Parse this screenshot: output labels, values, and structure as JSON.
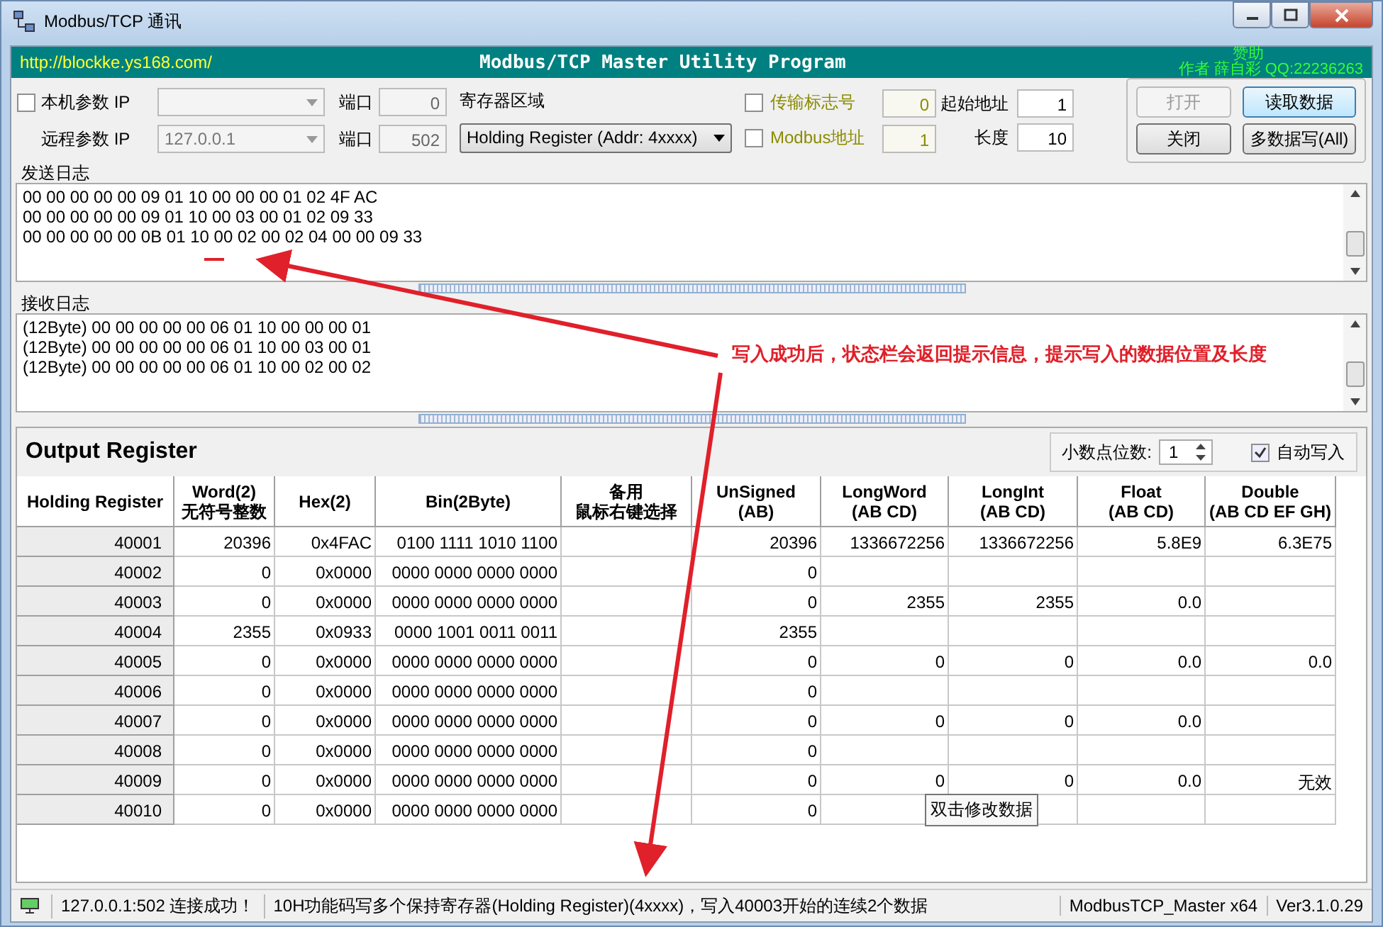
{
  "window": {
    "title": "Modbus/TCP 通讯"
  },
  "banner": {
    "url": "http://blockke.ys168.com/",
    "title": "Modbus/TCP Master Utility Program",
    "sponsor": "赞助",
    "author": "作者  薛自彩  QQ:22236263"
  },
  "local": {
    "label": "本机参数 IP",
    "checked": false,
    "port_label": "端口",
    "port": "0"
  },
  "remote": {
    "label": "远程参数 IP",
    "ip": "127.0.0.1",
    "port_label": "端口",
    "port": "502"
  },
  "register_area": {
    "label": "寄存器区域",
    "value": "Holding Register (Addr: 4xxxx)"
  },
  "options": [
    {
      "label": "传输标志号",
      "checked": false,
      "value": "0"
    },
    {
      "label": "Modbus地址",
      "checked": false,
      "value": "1"
    }
  ],
  "address": [
    {
      "label": "起始地址",
      "value": "1"
    },
    {
      "label": "长度",
      "value": "10"
    }
  ],
  "buttons": [
    {
      "label": "打开",
      "disabled": true,
      "selected": false
    },
    {
      "label": "读取数据",
      "disabled": false,
      "selected": true
    },
    {
      "label": "关闭",
      "disabled": false,
      "selected": false
    },
    {
      "label": "多数据写(All)",
      "disabled": false,
      "selected": false
    }
  ],
  "send_log": {
    "title": "发送日志",
    "lines": [
      "00 00 00 00 00 09 01 10 00 00 00 01 02 4F AC",
      "00 00 00 00 00 09 01 10 00 03 00 01 02 09 33",
      "00 00 00 00 00 0B 01 10 00 02 00 02 04 00 00 09 33"
    ]
  },
  "receive_log": {
    "title": "接收日志",
    "lines": [
      "(12Byte) 00 00 00 00 00 06 01 10 00 00 00 01",
      "(12Byte) 00 00 00 00 00 06 01 10 00 03 00 01",
      "(12Byte) 00 00 00 00 00 06 01 10 00 02 00 02"
    ]
  },
  "output": {
    "title": "Output Register",
    "decimals_label": "小数点位数:",
    "decimals": "1",
    "auto_write": {
      "label": "自动写入",
      "checked": true
    },
    "columns": [
      {
        "lines": [
          "Holding Register"
        ]
      },
      {
        "lines": [
          "Word(2)",
          "无符号整数"
        ]
      },
      {
        "lines": [
          "Hex(2)"
        ]
      },
      {
        "lines": [
          "Bin(2Byte)"
        ]
      },
      {
        "lines": [
          "备用",
          "鼠标右键选择"
        ]
      },
      {
        "lines": [
          "UnSigned",
          "(AB)"
        ]
      },
      {
        "lines": [
          "LongWord",
          "(AB CD)"
        ]
      },
      {
        "lines": [
          "LongInt",
          "(AB CD)"
        ]
      },
      {
        "lines": [
          "Float",
          "(AB CD)"
        ]
      },
      {
        "lines": [
          "Double",
          "(AB CD EF GH)"
        ]
      }
    ],
    "rows": [
      {
        "cells": [
          "40001",
          "20396",
          "0x4FAC",
          "0100 1111 1010 1100",
          "",
          "20396",
          "1336672256",
          "1336672256",
          "5.8E9",
          "6.3E75"
        ]
      },
      {
        "cells": [
          "40002",
          "0",
          "0x0000",
          "0000 0000 0000 0000",
          "",
          "0",
          "",
          "",
          "",
          ""
        ]
      },
      {
        "cells": [
          "40003",
          "0",
          "0x0000",
          "0000 0000 0000 0000",
          "",
          "0",
          "2355",
          "2355",
          "0.0",
          ""
        ]
      },
      {
        "cells": [
          "40004",
          "2355",
          "0x0933",
          "0000 1001 0011 0011",
          "",
          "2355",
          "",
          "",
          "",
          ""
        ]
      },
      {
        "cells": [
          "40005",
          "0",
          "0x0000",
          "0000 0000 0000 0000",
          "",
          "0",
          "0",
          "0",
          "0.0",
          "0.0"
        ]
      },
      {
        "cells": [
          "40006",
          "0",
          "0x0000",
          "0000 0000 0000 0000",
          "",
          "0",
          "",
          "",
          "",
          ""
        ]
      },
      {
        "cells": [
          "40007",
          "0",
          "0x0000",
          "0000 0000 0000 0000",
          "",
          "0",
          "0",
          "0",
          "0.0",
          ""
        ]
      },
      {
        "cells": [
          "40008",
          "0",
          "0x0000",
          "0000 0000 0000 0000",
          "",
          "0",
          "",
          "",
          "",
          ""
        ]
      },
      {
        "cells": [
          "40009",
          "0",
          "0x0000",
          "0000 0000 0000 0000",
          "",
          "0",
          "0",
          "0",
          "0.0",
          "无效"
        ]
      },
      {
        "cells": [
          "40010",
          "0",
          "0x0000",
          "0000 0000 0000 0000",
          "",
          "0",
          "",
          "",
          "",
          ""
        ]
      }
    ],
    "tooltip": "双击修改数据"
  },
  "annotation": "写入成功后，状态栏会返回提示信息，提示写入的数据位置及长度",
  "status_bar": [
    "127.0.0.1:502 连接成功！",
    "10H功能码写多个保持寄存器(Holding Register)(4xxxx)，写入40003开始的连续2个数据",
    "ModbusTCP_Master x64",
    "Ver3.1.0.29"
  ]
}
